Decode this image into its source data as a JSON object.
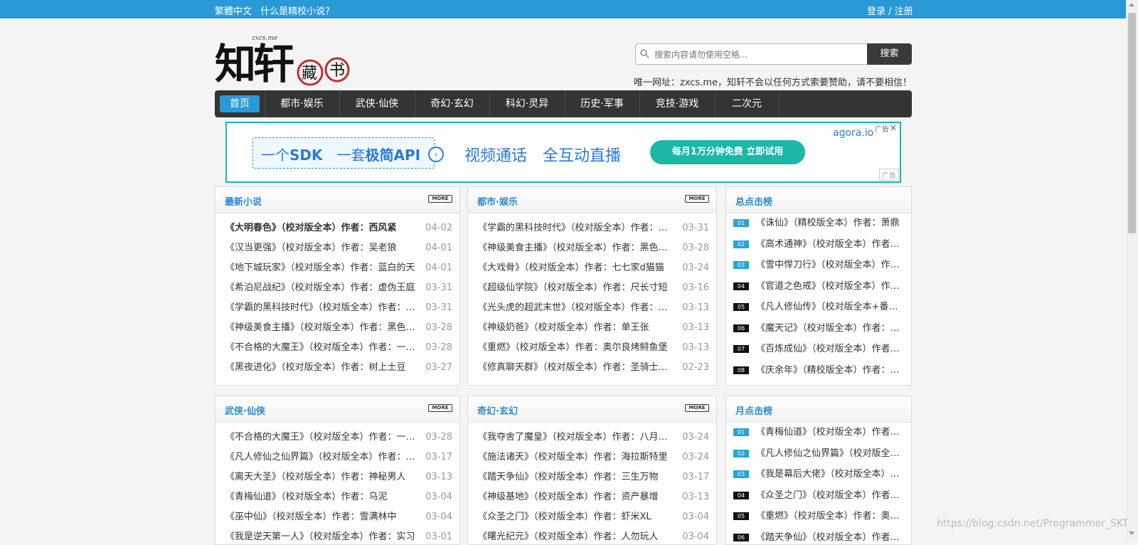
{
  "topbar": {
    "traditional": "繁體中文",
    "whatis": "什么是精校小说?",
    "login": "登录 / 注册"
  },
  "logo": {
    "small": "zxcs.me",
    "main": "知轩",
    "seal1": "藏",
    "seal2": "书"
  },
  "search": {
    "placeholder": "搜索内容请勿使用空格...",
    "button": "搜索"
  },
  "notice": "唯一网址：zxcs.me，知轩不会以任何方式索要赞助，请不要相信！",
  "nav": [
    "首页",
    "都市·娱乐",
    "武侠·仙侠",
    "奇幻·玄幻",
    "科幻·灵异",
    "历史·军事",
    "竞技·游戏",
    "二次元"
  ],
  "ad": {
    "t1a": "一个",
    "t1b": "SDK",
    "t1c": "一套",
    "t1d": "极简API",
    "t2": "视频通话　全互动直播",
    "pill": "每月1万分钟免费  立即试用",
    "brand": "agora.io",
    "label": "广告",
    "close": "✕",
    "label2": "广告"
  },
  "more": "MORE",
  "panels": {
    "latest": {
      "title": "最新小说",
      "rows": [
        {
          "t": "《大明春色》（校对版全本）作者：西风紧",
          "d": "04-02"
        },
        {
          "t": "《汉当更强》（校对版全本）作者：吴老狼",
          "d": "04-01"
        },
        {
          "t": "《地下城玩家》（校对版全本）作者：蓝白的天",
          "d": "04-01"
        },
        {
          "t": "《希泊尼战纪》（校对版全本）作者：虚伪王庭",
          "d": "03-31"
        },
        {
          "t": "《学霸的黑科技时代》（校对版全本）作者：晨星LL",
          "d": "03-31"
        },
        {
          "t": "《神级美食主播》（校对版全本）作者：黑色幽默",
          "d": "03-28"
        },
        {
          "t": "《不合格的大魔王》（校对版全本）作者：一世执念",
          "d": "03-28"
        },
        {
          "t": "《黑夜进化》（校对版全本）作者：树上土豆",
          "d": "03-27"
        }
      ]
    },
    "city": {
      "title": "都市·娱乐",
      "rows": [
        {
          "t": "《学霸的黑科技时代》（校对版全本）作者：晨星LL",
          "d": "03-31"
        },
        {
          "t": "《神级美食主播》（校对版全本）作者：黑色幽默",
          "d": "03-28"
        },
        {
          "t": "《大戏骨》（校对版全本）作者：七七家d猫猫",
          "d": "03-24"
        },
        {
          "t": "《超级仙学院》（校对版全本）作者：尺长寸短",
          "d": "03-16"
        },
        {
          "t": "《光头虎的超武末世》（校对版全本）作者：光头虎",
          "d": "03-13"
        },
        {
          "t": "《神级奶爸》（校对版全本）作者：单王张",
          "d": "03-13"
        },
        {
          "t": "《重燃》（校对版全本）作者：奥尔良烤鲟鱼堡",
          "d": "03-13"
        },
        {
          "t": "《修真聊天群》（校对版全本）作者：圣骑士的传说",
          "d": "02-23"
        }
      ]
    },
    "total": {
      "title": "总点击榜",
      "rows": [
        {
          "n": "01",
          "t": "《诛仙》（精校版全本）作者：萧鼎"
        },
        {
          "n": "02",
          "t": "《高术通神》（校对版全本）作者：手握寸关尺"
        },
        {
          "n": "03",
          "t": "《雪中悍刀行》（校对版全本）作者：烽火戏诸侯"
        },
        {
          "n": "04",
          "t": "《官道之色戒》（校对版全本）作者：三戒大师"
        },
        {
          "n": "05",
          "t": "《凡人修仙传》（校对版全本+番外）作者：忘语"
        },
        {
          "n": "06",
          "t": "《魔天记》（校对版全本）作者：忘语"
        },
        {
          "n": "07",
          "t": "《百炼成仙》（校对版全本）作者：幻雨"
        },
        {
          "n": "08",
          "t": "《庆余年》（精校版全本）作者：猫腻"
        }
      ]
    },
    "wuxia": {
      "title": "武侠·仙侠",
      "rows": [
        {
          "t": "《不合格的大魔王》（校对版全本）作者：一世执念",
          "d": "03-28"
        },
        {
          "t": "《凡人修仙之仙界篇》（校对版全本）作者：忘语",
          "d": "03-17"
        },
        {
          "t": "《离天大圣》（校对版全本）作者：神秘男人",
          "d": "03-13"
        },
        {
          "t": "《青梅仙道》（校对版全本）作者：乌泥",
          "d": "03-04"
        },
        {
          "t": "《巫中仙》（校对版全本）作者：雪满林中",
          "d": "03-04"
        },
        {
          "t": "《我是逆天第一人》（校对版全本）作者：实习",
          "d": "03-01"
        }
      ]
    },
    "fantasy": {
      "title": "奇幻·玄幻",
      "rows": [
        {
          "t": "《我夺舍了魔皇》（校对版全本）作者：八月飞鹰",
          "d": "03-24"
        },
        {
          "t": "《施法诸天》（校对版全本）作者：海拉斯特里",
          "d": "03-24"
        },
        {
          "t": "《踏天争仙》（校对版全本）作者：三生万物",
          "d": "03-17"
        },
        {
          "t": "《神级基地》（校对版全本）作者：资产暴增",
          "d": "03-13"
        },
        {
          "t": "《众圣之门》（校对版全本）作者：虾米XL",
          "d": "03-04"
        },
        {
          "t": "《曙光纪元》（校对版全本）作者：人勿玩人",
          "d": "03-04"
        }
      ]
    },
    "month": {
      "title": "月点击榜",
      "rows": [
        {
          "n": "01",
          "t": "《青梅仙道》（校对版全本）作者：乌泥"
        },
        {
          "n": "02",
          "t": "《凡人修仙之仙界篇》（校对版全本）作者：忘语"
        },
        {
          "n": "03",
          "t": "《我是幕后大佬》（校对版全本）作者：伪戒"
        },
        {
          "n": "04",
          "t": "《众圣之门》（校对版全本）作者：虾米XL"
        },
        {
          "n": "05",
          "t": "《重燃》（校对版全本）作者：奥尔良烤鲟鱼堡"
        },
        {
          "n": "06",
          "t": "《踏天争仙》（校对版全本）作者：三生万物"
        }
      ]
    }
  },
  "watermark": "https://blog.csdn.net/Programmer_SKT"
}
